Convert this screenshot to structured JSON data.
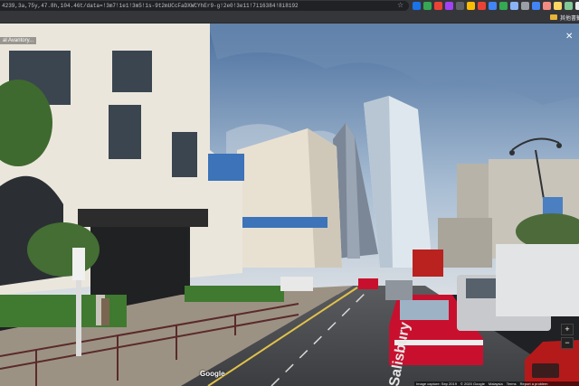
{
  "browser": {
    "url": "4239,3a,75y,47.8h,104.46t/data=!3m7!1e1!3m5!1s-9t2mUCcFaDXWCYhEr9-g!2e0!3e11!7i16384!8i8192",
    "bookmark_folder": "其他書籤",
    "extension_colors": [
      "#1a73e8",
      "#34a853",
      "#ea4335",
      "#a142f4",
      "#5f6368",
      "#fbbc04",
      "#ea4335",
      "#4285f4",
      "#34a853",
      "#8ab4f8",
      "#9aa0a6",
      "#4285f4",
      "#f28b82",
      "#fdd663",
      "#81c995",
      "#e8eaed"
    ]
  },
  "streetview": {
    "place_title": "al Avantory...",
    "close_icon": "close-icon",
    "logo": "Google",
    "street_marking": "Salisbury",
    "footer": [
      "Image capture: Sep 2019",
      "© 2020 Google",
      "Malaysia",
      "Terms",
      "Report a problem"
    ],
    "controls": {
      "zoom_in": "+",
      "zoom_out": "−"
    }
  }
}
